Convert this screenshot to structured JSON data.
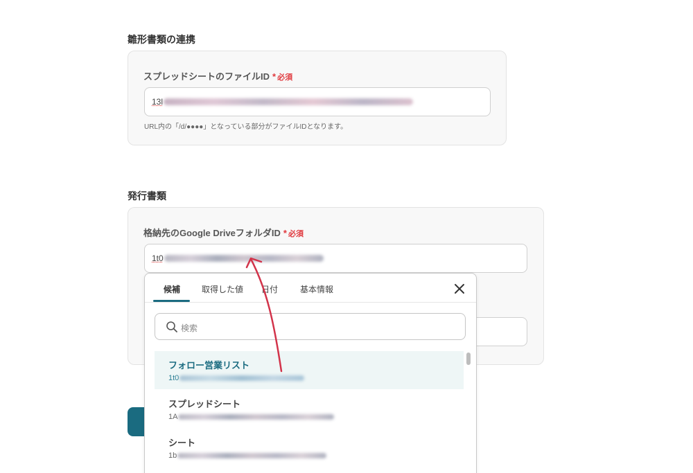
{
  "section1": {
    "title": "雛形書類の連携",
    "label": "スプレッドシートのファイルID",
    "required_mark": "*",
    "required_text": "必須",
    "value_prefix": "13l",
    "help": "URL内の「/d/●●●●」となっている部分がファイルIDとなります。"
  },
  "section2": {
    "title": "発行書類",
    "label": "格納先のGoogle DriveフォルダID",
    "required_mark": "*",
    "required_text": "必須",
    "value_prefix": "1t0"
  },
  "dropdown": {
    "tabs": [
      {
        "label": "候補",
        "active": true
      },
      {
        "label": "取得した値",
        "active": false
      },
      {
        "label": "日付",
        "active": false
      },
      {
        "label": "基本情報",
        "active": false
      }
    ],
    "search_placeholder": "検索",
    "items": [
      {
        "title": "フォロー営業リスト",
        "sub_prefix": "1t0",
        "highlighted": true
      },
      {
        "title": "スプレッドシート",
        "sub_prefix": "1A",
        "highlighted": false
      },
      {
        "title": "シート",
        "sub_prefix": "1b",
        "highlighted": false
      }
    ]
  },
  "icons": {
    "close": "close-icon",
    "search": "search-icon"
  },
  "colors": {
    "accent": "#1a6b80",
    "required": "#e0393e",
    "annotation_arrow": "#d2334a",
    "highlight_bg": "#eef6f6"
  }
}
